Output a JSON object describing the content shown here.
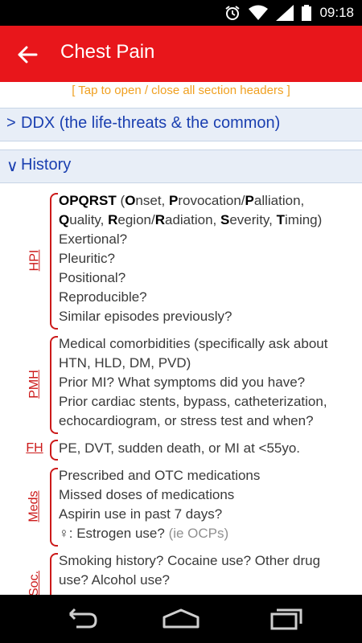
{
  "status_bar": {
    "time": "09:18",
    "icons": [
      "alarm-icon",
      "wifi-icon",
      "signal-icon",
      "battery-icon"
    ]
  },
  "app_bar": {
    "title": "Chest Pain",
    "back_icon": "back-arrow-icon"
  },
  "toggle_note": "[ Tap to open / close all section headers ]",
  "sections": [
    {
      "chevron": ">",
      "label": "DDX (the life-threats & the common)",
      "state": "collapsed"
    },
    {
      "chevron": "∨",
      "label": "History",
      "state": "expanded"
    }
  ],
  "history": {
    "hpi": {
      "tag": "HPI",
      "opqrst": {
        "acronym": "OPQRST",
        "open": " (",
        "o": "O",
        "onset": "nset, ",
        "p": "P",
        "provocation": "rovocation/",
        "p2": "P",
        "palliation": "alliation,",
        "q": "Q",
        "quality": "uality, ",
        "r": "R",
        "region": "egion/",
        "r2": "R",
        "radiation": "adiation, ",
        "s": "S",
        "severity": "everity, ",
        "t": "T",
        "timing": "iming)"
      },
      "lines": [
        "Exertional?",
        "Pleuritic?",
        "Positional?",
        "Reproducible?",
        "Similar episodes previously?"
      ]
    },
    "pmh": {
      "tag": "PMH",
      "lines": [
        "Medical comorbidities (specifically ask about",
        "HTN, HLD, DM, PVD)",
        "Prior MI? What symptoms did you have?",
        "Prior cardiac stents, bypass, catheterization,",
        "echocardiogram, or stress test and when?"
      ]
    },
    "fh": {
      "tag": "FH",
      "lines": [
        "PE, DVT, sudden death, or MI at <55yo."
      ]
    },
    "meds": {
      "tag": "Meds",
      "lines": [
        "Prescribed and OTC medications",
        "Missed doses of medications",
        "Aspirin use in past 7 days?"
      ],
      "female_line": "♀: Estrogen use? ",
      "female_note": "(ie OCPs)"
    },
    "soc": {
      "tag": "Soc.",
      "lines": [
        "Smoking history? Cocaine use? Other drug",
        "use? Alcohol use?"
      ]
    }
  },
  "nav_bar": {
    "buttons": [
      "back-icon",
      "home-icon",
      "recents-icon"
    ]
  }
}
